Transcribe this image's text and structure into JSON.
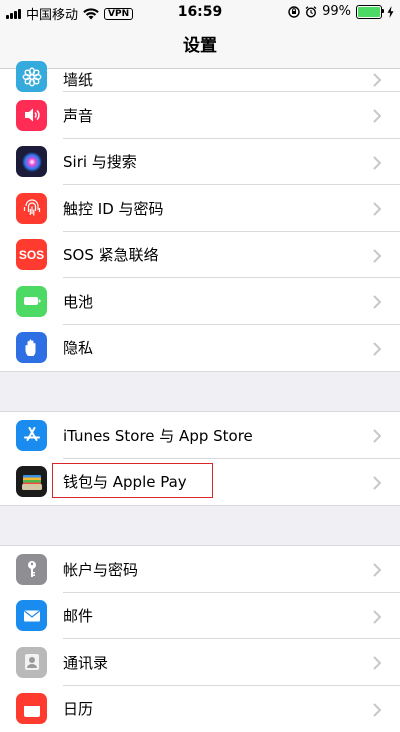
{
  "status_bar": {
    "carrier": "中国移动",
    "vpn": "VPN",
    "time": "16:59",
    "battery_percent": "99%",
    "battery_level": 0.99
  },
  "nav": {
    "title": "设置"
  },
  "groups": [
    [
      {
        "label": "墙纸",
        "icon": "flower-icon",
        "color": "#35aadc"
      },
      {
        "label": "声音",
        "icon": "speaker-icon",
        "color": "#ff2d55"
      },
      {
        "label": "Siri 与搜索",
        "icon": "siri-icon",
        "color": "#1c1c3a"
      },
      {
        "label": "触控 ID 与密码",
        "icon": "fingerprint-icon",
        "color": "#ff3b30"
      },
      {
        "label": "SOS 紧急联络",
        "icon": "sos-icon",
        "color": "#ff3b30",
        "icon_text": "SOS"
      },
      {
        "label": "电池",
        "icon": "battery-icon",
        "color": "#4cd964"
      },
      {
        "label": "隐私",
        "icon": "hand-icon",
        "color": "#2f6fe4"
      }
    ],
    [
      {
        "label": "iTunes Store 与 App Store",
        "icon": "app-store-icon",
        "color": "#1a8cf0"
      },
      {
        "label": "钱包与 Apple Pay",
        "icon": "wallet-icon",
        "color": "#1b1b1b",
        "highlighted": true
      }
    ],
    [
      {
        "label": "帐户与密码",
        "icon": "key-icon",
        "color": "#8e8e93"
      },
      {
        "label": "邮件",
        "icon": "mail-icon",
        "color": "#1a8cf0"
      },
      {
        "label": "通讯录",
        "icon": "contacts-icon",
        "color": "#b9b9b9"
      },
      {
        "label": "日历",
        "icon": "calendar-icon",
        "color": "#ff3b30"
      }
    ]
  ]
}
